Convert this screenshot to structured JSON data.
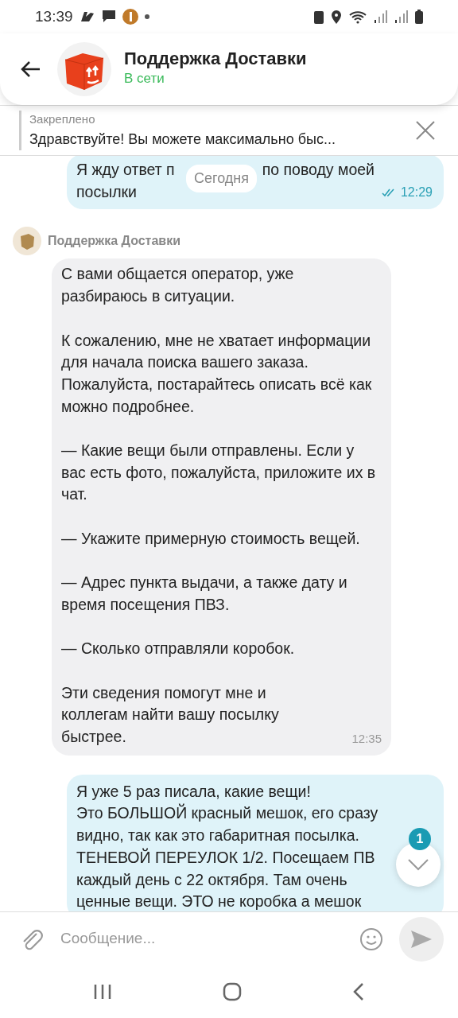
{
  "status_bar": {
    "time": "13:39"
  },
  "header": {
    "title": "Поддержка Доставки",
    "status": "В сети",
    "online": true
  },
  "pinned": {
    "label": "Закреплено",
    "text": "Здравствуйте! Вы можете максимально быс..."
  },
  "date_divider": "Сегодня",
  "messages": [
    {
      "kind": "outgoing",
      "text_parts": [
        "Я жду ответ п",
        "по поводу моей",
        "посылки"
      ],
      "time": "12:29",
      "read": true
    },
    {
      "kind": "incoming",
      "sender": "Поддержка Доставки",
      "paragraphs": [
        "С вами общается оператор, уже разбираюсь в ситуации.",
        "К сожалению, мне не хватает информации для начала поиска вашего заказа. Пожалуйста, постарайтесь описать всё как можно подробнее.",
        "— Какие вещи были отправлены. Если у вас есть фото, пожалуйста, приложите их в чат.",
        "— Укажите примерную стоимость вещей.",
        "— Адрес пункта выдачи, а также дату и время посещения ПВЗ.",
        "— Сколько отправляли коробок.",
        "Эти сведения помогут мне и коллегам найти вашу посылку быстрее."
      ],
      "time": "12:35"
    },
    {
      "kind": "outgoing",
      "lines": [
        "Я уже 5 раз писала, какие вещи!",
        "Это БОЛЬШОЙ красный мешок, его сразу",
        "видно,  так как это габаритная посылка.",
        "ТЕНЕВОЙ ПЕРЕУЛОК 1/2. Посещаем ПВ",
        "каждый день с 22 октября.  Там очень",
        "ценные вещи. ЭТО не коробка а мешок"
      ]
    }
  ],
  "scroll_button": {
    "badge": "1"
  },
  "composer": {
    "placeholder": "Сообщение..."
  }
}
